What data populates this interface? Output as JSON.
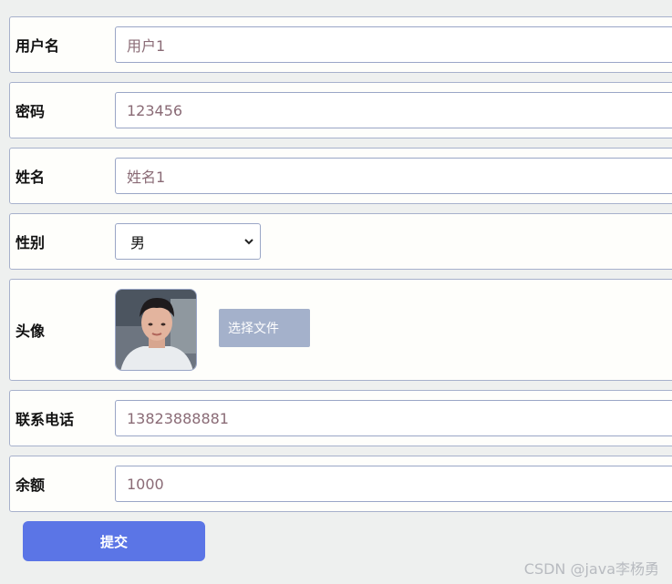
{
  "form": {
    "username": {
      "label": "用户名",
      "value": "用户1"
    },
    "password": {
      "label": "密码",
      "value": "123456"
    },
    "name": {
      "label": "姓名",
      "value": "姓名1"
    },
    "gender": {
      "label": "性别",
      "selected": "男"
    },
    "avatar": {
      "label": "头像",
      "choose_file_label": "选择文件"
    },
    "phone": {
      "label": "联系电话",
      "value": "13823888881"
    },
    "balance": {
      "label": "余额",
      "value": "1000"
    },
    "submit_label": "提交"
  },
  "watermark": "CSDN @java李杨勇",
  "colors": {
    "accent": "#5b75e6",
    "file_button": "#a4b1cb",
    "border": "#a7b1cc"
  }
}
